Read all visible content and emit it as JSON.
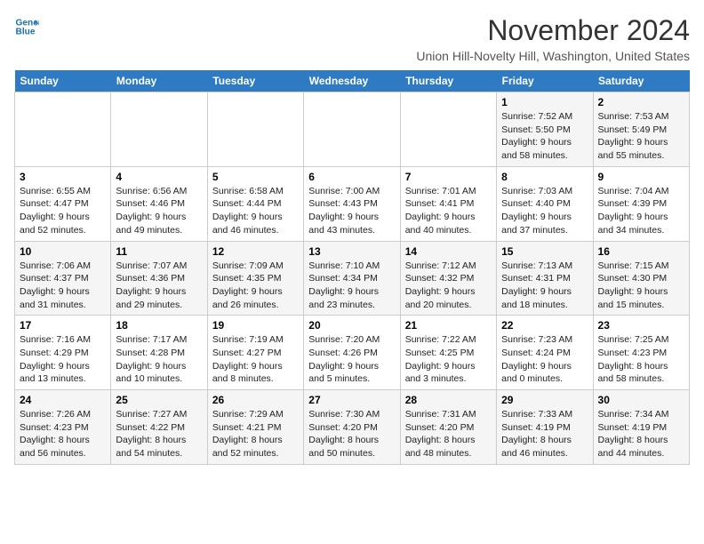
{
  "header": {
    "logo_line1": "General",
    "logo_line2": "Blue",
    "month": "November 2024",
    "location": "Union Hill-Novelty Hill, Washington, United States"
  },
  "days_of_week": [
    "Sunday",
    "Monday",
    "Tuesday",
    "Wednesday",
    "Thursday",
    "Friday",
    "Saturday"
  ],
  "weeks": [
    {
      "days": [
        {
          "num": "",
          "info": ""
        },
        {
          "num": "",
          "info": ""
        },
        {
          "num": "",
          "info": ""
        },
        {
          "num": "",
          "info": ""
        },
        {
          "num": "",
          "info": ""
        },
        {
          "num": "1",
          "info": "Sunrise: 7:52 AM\nSunset: 5:50 PM\nDaylight: 9 hours\nand 58 minutes."
        },
        {
          "num": "2",
          "info": "Sunrise: 7:53 AM\nSunset: 5:49 PM\nDaylight: 9 hours\nand 55 minutes."
        }
      ]
    },
    {
      "days": [
        {
          "num": "3",
          "info": "Sunrise: 6:55 AM\nSunset: 4:47 PM\nDaylight: 9 hours\nand 52 minutes."
        },
        {
          "num": "4",
          "info": "Sunrise: 6:56 AM\nSunset: 4:46 PM\nDaylight: 9 hours\nand 49 minutes."
        },
        {
          "num": "5",
          "info": "Sunrise: 6:58 AM\nSunset: 4:44 PM\nDaylight: 9 hours\nand 46 minutes."
        },
        {
          "num": "6",
          "info": "Sunrise: 7:00 AM\nSunset: 4:43 PM\nDaylight: 9 hours\nand 43 minutes."
        },
        {
          "num": "7",
          "info": "Sunrise: 7:01 AM\nSunset: 4:41 PM\nDaylight: 9 hours\nand 40 minutes."
        },
        {
          "num": "8",
          "info": "Sunrise: 7:03 AM\nSunset: 4:40 PM\nDaylight: 9 hours\nand 37 minutes."
        },
        {
          "num": "9",
          "info": "Sunrise: 7:04 AM\nSunset: 4:39 PM\nDaylight: 9 hours\nand 34 minutes."
        }
      ]
    },
    {
      "days": [
        {
          "num": "10",
          "info": "Sunrise: 7:06 AM\nSunset: 4:37 PM\nDaylight: 9 hours\nand 31 minutes."
        },
        {
          "num": "11",
          "info": "Sunrise: 7:07 AM\nSunset: 4:36 PM\nDaylight: 9 hours\nand 29 minutes."
        },
        {
          "num": "12",
          "info": "Sunrise: 7:09 AM\nSunset: 4:35 PM\nDaylight: 9 hours\nand 26 minutes."
        },
        {
          "num": "13",
          "info": "Sunrise: 7:10 AM\nSunset: 4:34 PM\nDaylight: 9 hours\nand 23 minutes."
        },
        {
          "num": "14",
          "info": "Sunrise: 7:12 AM\nSunset: 4:32 PM\nDaylight: 9 hours\nand 20 minutes."
        },
        {
          "num": "15",
          "info": "Sunrise: 7:13 AM\nSunset: 4:31 PM\nDaylight: 9 hours\nand 18 minutes."
        },
        {
          "num": "16",
          "info": "Sunrise: 7:15 AM\nSunset: 4:30 PM\nDaylight: 9 hours\nand 15 minutes."
        }
      ]
    },
    {
      "days": [
        {
          "num": "17",
          "info": "Sunrise: 7:16 AM\nSunset: 4:29 PM\nDaylight: 9 hours\nand 13 minutes."
        },
        {
          "num": "18",
          "info": "Sunrise: 7:17 AM\nSunset: 4:28 PM\nDaylight: 9 hours\nand 10 minutes."
        },
        {
          "num": "19",
          "info": "Sunrise: 7:19 AM\nSunset: 4:27 PM\nDaylight: 9 hours\nand 8 minutes."
        },
        {
          "num": "20",
          "info": "Sunrise: 7:20 AM\nSunset: 4:26 PM\nDaylight: 9 hours\nand 5 minutes."
        },
        {
          "num": "21",
          "info": "Sunrise: 7:22 AM\nSunset: 4:25 PM\nDaylight: 9 hours\nand 3 minutes."
        },
        {
          "num": "22",
          "info": "Sunrise: 7:23 AM\nSunset: 4:24 PM\nDaylight: 9 hours\nand 0 minutes."
        },
        {
          "num": "23",
          "info": "Sunrise: 7:25 AM\nSunset: 4:23 PM\nDaylight: 8 hours\nand 58 minutes."
        }
      ]
    },
    {
      "days": [
        {
          "num": "24",
          "info": "Sunrise: 7:26 AM\nSunset: 4:23 PM\nDaylight: 8 hours\nand 56 minutes."
        },
        {
          "num": "25",
          "info": "Sunrise: 7:27 AM\nSunset: 4:22 PM\nDaylight: 8 hours\nand 54 minutes."
        },
        {
          "num": "26",
          "info": "Sunrise: 7:29 AM\nSunset: 4:21 PM\nDaylight: 8 hours\nand 52 minutes."
        },
        {
          "num": "27",
          "info": "Sunrise: 7:30 AM\nSunset: 4:20 PM\nDaylight: 8 hours\nand 50 minutes."
        },
        {
          "num": "28",
          "info": "Sunrise: 7:31 AM\nSunset: 4:20 PM\nDaylight: 8 hours\nand 48 minutes."
        },
        {
          "num": "29",
          "info": "Sunrise: 7:33 AM\nSunset: 4:19 PM\nDaylight: 8 hours\nand 46 minutes."
        },
        {
          "num": "30",
          "info": "Sunrise: 7:34 AM\nSunset: 4:19 PM\nDaylight: 8 hours\nand 44 minutes."
        }
      ]
    }
  ]
}
